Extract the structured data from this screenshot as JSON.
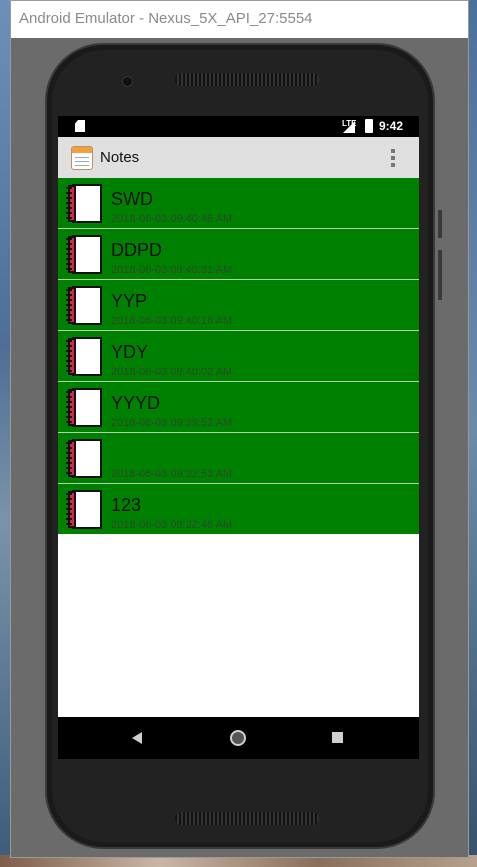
{
  "window": {
    "title": "Android Emulator - Nexus_5X_API_27:5554"
  },
  "statusbar": {
    "network": "LTE",
    "time": "9:42"
  },
  "actionbar": {
    "title": "Notes",
    "app_icon": "notepad-icon",
    "menu_icon": "overflow-menu-icon"
  },
  "notes": [
    {
      "title": "SWD",
      "timestamp": "2018-06-03 09:40:46 AM"
    },
    {
      "title": "DDPD",
      "timestamp": "2018-06-03 09:40:31 AM"
    },
    {
      "title": "YYP",
      "timestamp": "2018-06-03 09:40:16 AM"
    },
    {
      "title": "YDY",
      "timestamp": "2018-06-03 09:40:02 AM"
    },
    {
      "title": "YYYD",
      "timestamp": "2018-06-03 09:39:52 AM"
    },
    {
      "title": "",
      "timestamp": "2018-06-03 09:22:53 AM"
    },
    {
      "title": "123",
      "timestamp": "2018-06-03 09:22:46 AM"
    }
  ],
  "navbar": {
    "back_icon": "back-icon",
    "home_icon": "home-icon",
    "recents_icon": "recents-icon"
  },
  "colors": {
    "list_background": "#008000",
    "actionbar": "#e0e0e0"
  }
}
